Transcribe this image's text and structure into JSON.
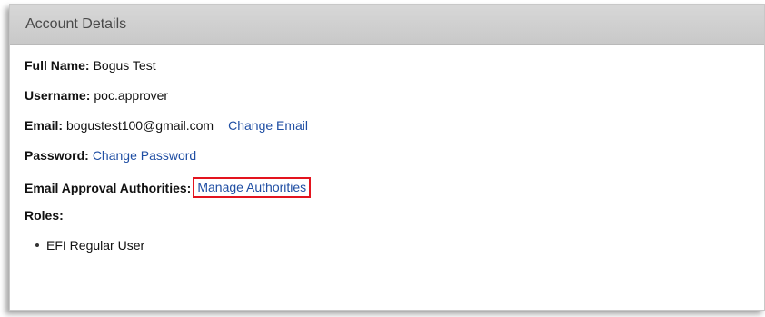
{
  "panel": {
    "title": "Account Details"
  },
  "fields": {
    "full_name_label": "Full Name:",
    "full_name_value": "Bogus Test",
    "username_label": "Username:",
    "username_value": "poc.approver",
    "email_label": "Email:",
    "email_value": "bogustest100@gmail.com",
    "change_email_link": "Change Email",
    "password_label": "Password:",
    "change_password_link": "Change Password",
    "authorities_label": "Email Approval Authorities:",
    "manage_authorities_link": "Manage Authorities",
    "roles_label": "Roles:"
  },
  "roles": [
    "EFI Regular User"
  ],
  "colors": {
    "link": "#1f4ea3",
    "highlight_border": "#e3141e",
    "header_bg": "#cfcfcf"
  },
  "icons": {
    "bullet": "bullet-icon"
  }
}
